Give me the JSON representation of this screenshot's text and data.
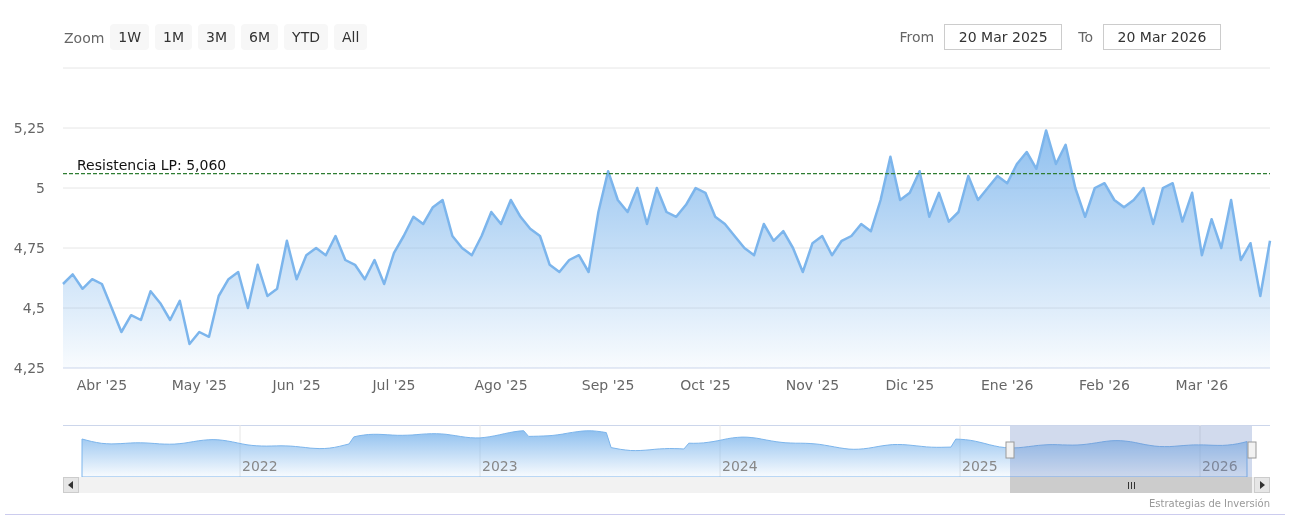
{
  "range_selector": {
    "label": "Zoom",
    "buttons": [
      {
        "label": "1W",
        "selected": false
      },
      {
        "label": "1M",
        "selected": false
      },
      {
        "label": "3M",
        "selected": false
      },
      {
        "label": "6M",
        "selected": false
      },
      {
        "label": "YTD",
        "selected": false
      },
      {
        "label": "All",
        "selected": false
      }
    ]
  },
  "date_range": {
    "from_label": "From",
    "from": "20 Mar 2025",
    "to_label": "To",
    "to": "20 Mar 2026"
  },
  "chart": {
    "chart_data": {
      "type": "area",
      "grid": true,
      "ylim": [
        4.25,
        5.5
      ],
      "categories": [
        null,
        null,
        null,
        null,
        "Abr '25",
        null,
        null,
        null,
        null,
        null,
        null,
        null,
        null,
        null,
        "May '25",
        null,
        null,
        null,
        null,
        null,
        null,
        null,
        null,
        null,
        "Jun '25",
        null,
        null,
        null,
        null,
        null,
        null,
        null,
        null,
        null,
        "Jul '25",
        null,
        null,
        null,
        null,
        null,
        null,
        null,
        null,
        null,
        null,
        "Ago '25",
        null,
        null,
        null,
        null,
        null,
        null,
        null,
        null,
        null,
        null,
        "Sep '25",
        null,
        null,
        null,
        null,
        null,
        null,
        null,
        null,
        null,
        "Oct '25",
        null,
        null,
        null,
        null,
        null,
        null,
        null,
        null,
        null,
        null,
        "Nov '25",
        null,
        null,
        null,
        null,
        null,
        null,
        null,
        null,
        null,
        "Dic '25",
        null,
        null,
        null,
        null,
        null,
        null,
        null,
        null,
        null,
        "Ene '26",
        null,
        null,
        null,
        null,
        null,
        null,
        null,
        null,
        null,
        "Feb '26",
        null,
        null,
        null,
        null,
        null,
        null,
        null,
        null,
        null,
        "Mar '26",
        null,
        null,
        null,
        null,
        null,
        null,
        null
      ],
      "yticks": [
        {
          "value": 4.25,
          "label": "4,25"
        },
        {
          "value": 4.5,
          "label": "4,5"
        },
        {
          "value": 4.75,
          "label": "4,75"
        },
        {
          "value": 5,
          "label": "5"
        },
        {
          "value": 5.25,
          "label": "5,25"
        }
      ],
      "series": [
        {
          "color": "#7cb5ec",
          "values": [
            4.6,
            4.64,
            4.58,
            4.62,
            4.6,
            4.5,
            4.4,
            4.47,
            4.45,
            4.57,
            4.52,
            4.45,
            4.53,
            4.35,
            4.4,
            4.38,
            4.55,
            4.62,
            4.65,
            4.5,
            4.68,
            4.55,
            4.58,
            4.78,
            4.62,
            4.72,
            4.75,
            4.72,
            4.8,
            4.7,
            4.68,
            4.62,
            4.7,
            4.6,
            4.73,
            4.8,
            4.88,
            4.85,
            4.92,
            4.95,
            4.8,
            4.75,
            4.72,
            4.8,
            4.9,
            4.85,
            4.95,
            4.88,
            4.83,
            4.8,
            4.68,
            4.65,
            4.7,
            4.72,
            4.65,
            4.9,
            5.07,
            4.95,
            4.9,
            5.0,
            4.85,
            5.0,
            4.9,
            4.88,
            4.93,
            5.0,
            4.98,
            4.88,
            4.85,
            4.8,
            4.75,
            4.72,
            4.85,
            4.78,
            4.82,
            4.75,
            4.65,
            4.77,
            4.8,
            4.72,
            4.78,
            4.8,
            4.85,
            4.82,
            4.95,
            5.13,
            4.95,
            4.98,
            5.07,
            4.88,
            4.98,
            4.86,
            4.9,
            5.05,
            4.95,
            5.0,
            5.05,
            5.02,
            5.1,
            5.15,
            5.08,
            5.24,
            5.1,
            5.18,
            5.0,
            4.88,
            5.0,
            5.02,
            4.95,
            4.92,
            4.95,
            5.0,
            4.85,
            5.0,
            5.02,
            4.86,
            4.98,
            4.72,
            4.87,
            4.75,
            4.95,
            4.7,
            4.77,
            4.55,
            4.78
          ]
        }
      ],
      "ref_lines": [
        {
          "axis": "y",
          "value": 5.06,
          "label": "Resistencia LP: 5,060",
          "color": "#2e7d32"
        }
      ]
    }
  },
  "navigator": {
    "year_labels": [
      "2022",
      "2023",
      "2024",
      "2025",
      "2026"
    ]
  },
  "credits": "Estrategias de Inversión"
}
